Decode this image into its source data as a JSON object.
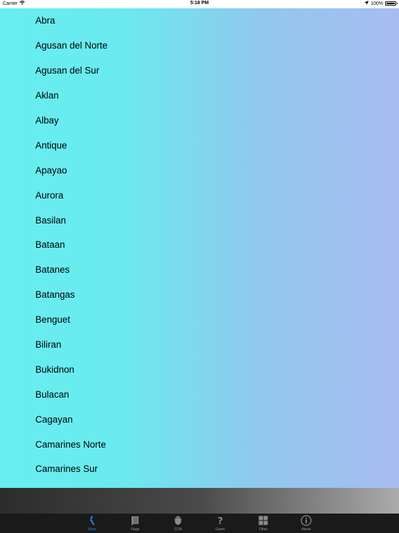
{
  "status_bar": {
    "carrier": "Carrier",
    "time": "5:18 PM",
    "battery_text": "100%"
  },
  "provinces": [
    "Abra",
    "Agusan del Norte",
    "Agusan del Sur",
    "Aklan",
    "Albay",
    "Antique",
    "Apayao",
    "Aurora",
    "Basilan",
    "Bataan",
    "Batanes",
    "Batangas",
    "Benguet",
    "Biliran",
    "Bukidnon",
    "Bulacan",
    "Cagayan",
    "Camarines Norte",
    "Camarines Sur"
  ],
  "tab_bar": {
    "active_color": "#2a7bd8",
    "tabs": [
      {
        "label": "Maps",
        "icon": "maps-icon"
      },
      {
        "label": "Flags",
        "icon": "flags-icon"
      },
      {
        "label": "COA",
        "icon": "coa-icon"
      },
      {
        "label": "Game",
        "icon": "game-icon"
      },
      {
        "label": "Other",
        "icon": "other-icon"
      },
      {
        "label": "About",
        "icon": "about-icon"
      }
    ]
  }
}
